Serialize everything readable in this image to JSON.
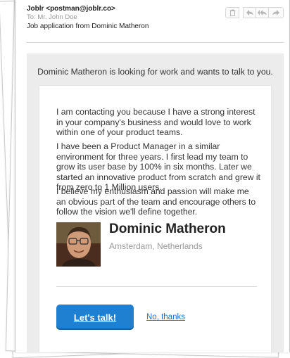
{
  "email": {
    "from": "Joblr <postman@joblr.co>",
    "to_label": "To:",
    "to": "Mr. John Doe",
    "subject": "Job application from Dominic Matheron"
  },
  "toolbar": {
    "icons": [
      "trash-icon",
      "reply-icon",
      "reply-all-icon",
      "forward-icon"
    ]
  },
  "message": {
    "intro": "Dominic Matheron is looking for work and wants to talk to you.",
    "paragraphs": [
      "I am contacting you because I have a strong interest in your company's business and would love to work within one of your product teams.",
      "I have been a Product Manager in a similar environment for three years. I first lead my team to grow its user base by 100% in six months. Later we started an innovative product from scratch and grew it from zero to 1 Million users.",
      "I believe my enthusiasm and passion will make me an obvious part of the team and encourage others to follow the vision we'll define together."
    ]
  },
  "profile": {
    "name": "Dominic Matheron",
    "location": "Amsterdam, Netherlands"
  },
  "actions": {
    "primary": "Let's talk!",
    "secondary": "No, thanks"
  },
  "colors": {
    "accent": "#1f7fd0",
    "link": "#1b6fcf",
    "panel": "#ececec"
  }
}
